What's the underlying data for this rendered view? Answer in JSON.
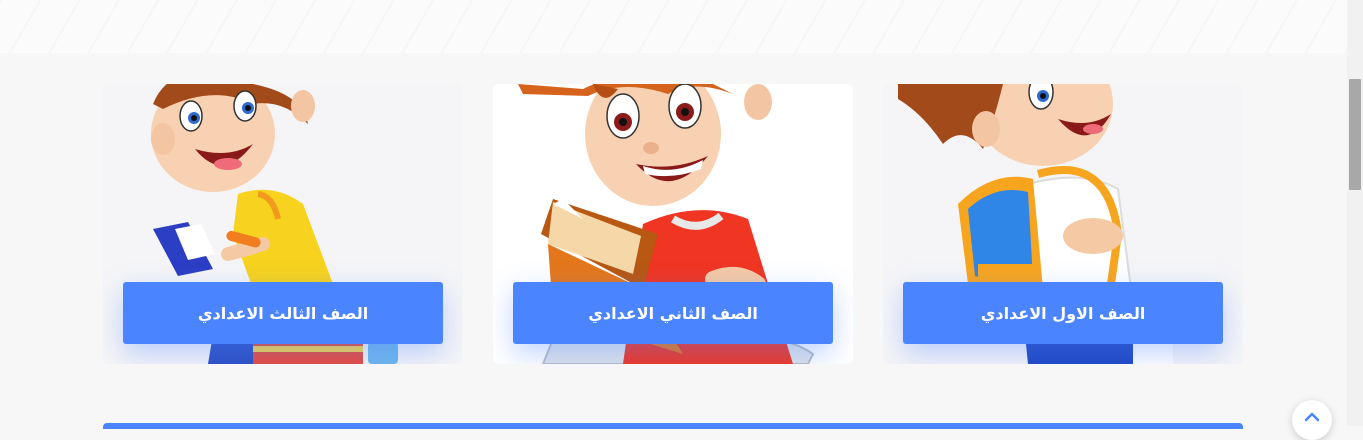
{
  "grades": [
    {
      "label": "الصف الثالث الاعدادي",
      "illustration": "boy-reading-sitting-on-books"
    },
    {
      "label": "الصف الثاني الاعدادي",
      "illustration": "boy-reading-orange-book"
    },
    {
      "label": "الصف الاول الاعدادي",
      "illustration": "boy-with-school-backpack"
    }
  ],
  "icons": {
    "scroll_top": "chevron-up-icon"
  },
  "colors": {
    "accent": "#4a84ff",
    "card_bg": "#f5f5f7",
    "page_bg": "#f7f7f8"
  }
}
